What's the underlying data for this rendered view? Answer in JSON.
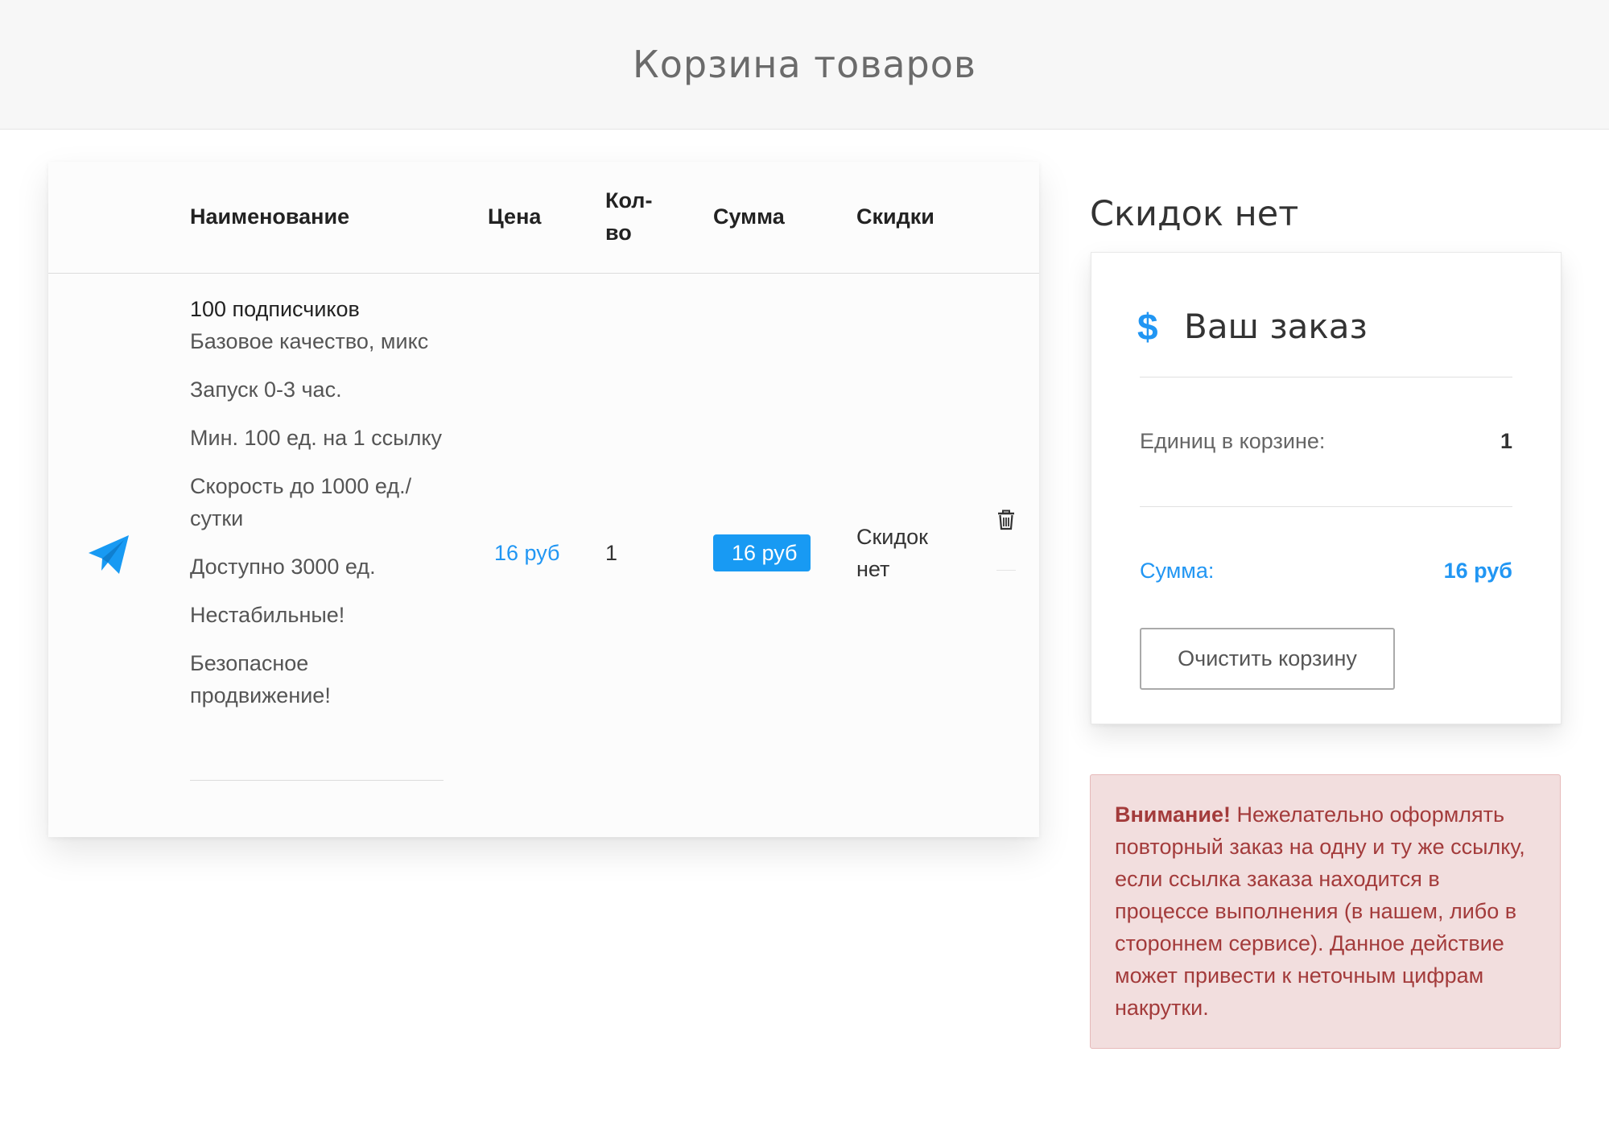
{
  "header": {
    "title": "Корзина товаров"
  },
  "table": {
    "columns": {
      "name": "Наименование",
      "price": "Цена",
      "qty_line1": "Кол-",
      "qty_line2": "во",
      "sum": "Сумма",
      "discount": "Скидки"
    },
    "row": {
      "icon": "paper-plane-icon",
      "name": "100 подписчиков",
      "details": [
        "Базовое качество, микс",
        "Запуск 0-3 час.",
        "Мин. 100 ед. на 1 ссылку",
        "Скорость до 1000 ед./ сутки",
        "Доступно 3000 ед.",
        "Нестабильные!",
        "Безопасное продвижение!"
      ],
      "price": "16 руб",
      "qty": "1",
      "sum": "16 руб",
      "discount_line1": "Скидок",
      "discount_line2": "нет"
    }
  },
  "sidebar": {
    "discount_title": "Скидок нет",
    "order": {
      "icon": "dollar-icon",
      "title": "Ваш заказ",
      "units_label": "Единиц в корзине:",
      "units_value": "1",
      "sum_label": "Сумма:",
      "sum_value": "16 руб",
      "clear_button": "Очистить корзину"
    },
    "alert": {
      "strong": "Внимание!",
      "text": " Нежелательно оформлять повторный заказ на одну и ту же ссылку, если ссылка заказа находится в процессе выполнения (в нашем, либо в стороннем сервисе). Данное действие может привести к неточным цифрам накрутки."
    }
  },
  "colors": {
    "accent": "#2196f3",
    "badge": "#189af3",
    "alert_bg": "#f2dede",
    "alert_text": "#a33b3b"
  }
}
